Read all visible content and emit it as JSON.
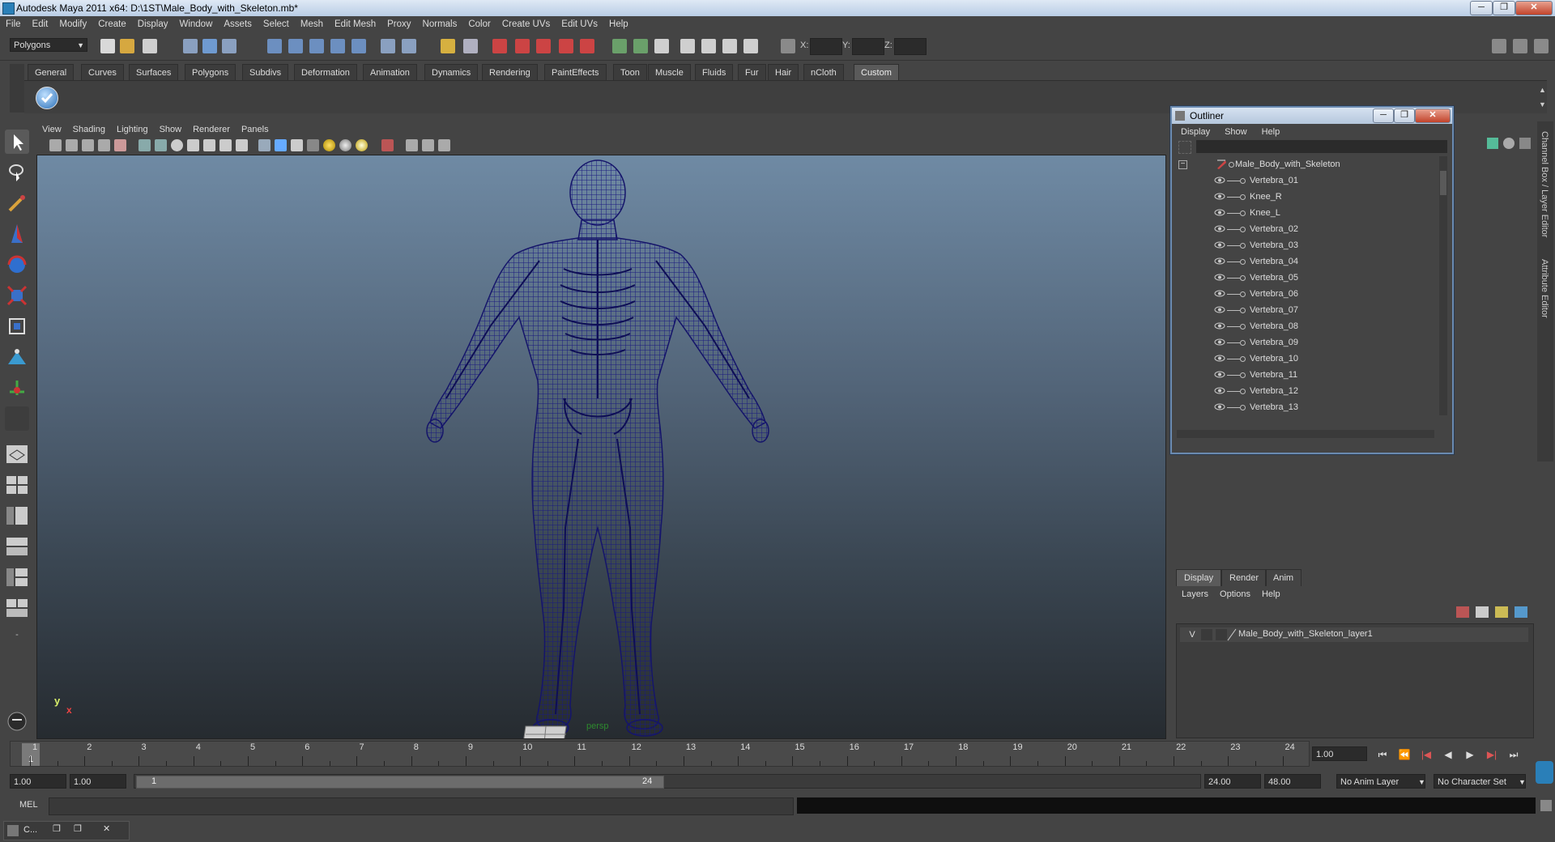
{
  "window": {
    "title": "Autodesk Maya 2011 x64: D:\\1ST\\Male_Body_with_Skeleton.mb*",
    "minimize": "─",
    "restore": "❐",
    "close": "✕"
  },
  "menu": [
    "File",
    "Edit",
    "Modify",
    "Create",
    "Display",
    "Window",
    "Assets",
    "Select",
    "Mesh",
    "Edit Mesh",
    "Proxy",
    "Normals",
    "Color",
    "Create UVs",
    "Edit UVs",
    "Help"
  ],
  "status_line": {
    "mode": "Polygons",
    "x_label": "X:",
    "y_label": "Y:",
    "z_label": "Z:"
  },
  "shelf_tabs": [
    "General",
    "Curves",
    "Surfaces",
    "Polygons",
    "Subdivs",
    "Deformation",
    "Animation",
    "Dynamics",
    "Rendering",
    "PaintEffects",
    "Toon",
    "Muscle",
    "Fluids",
    "Fur",
    "Hair",
    "nCloth",
    "Custom"
  ],
  "active_shelf": "Custom",
  "viewport": {
    "menu": [
      "View",
      "Shading",
      "Lighting",
      "Show",
      "Renderer",
      "Panels"
    ],
    "camera_label": "persp",
    "axis_y": "y",
    "axis_x": "x",
    "wire_color": "#1c1c7a"
  },
  "outliner": {
    "title": "Outliner",
    "menu": [
      "Display",
      "Show",
      "Help"
    ],
    "root": "Male_Body_with_Skeleton",
    "collapse_glyph": "−",
    "items": [
      "Vertebra_01",
      "Knee_R",
      "Knee_L",
      "Vertebra_02",
      "Vertebra_03",
      "Vertebra_04",
      "Vertebra_05",
      "Vertebra_06",
      "Vertebra_07",
      "Vertebra_08",
      "Vertebra_09",
      "Vertebra_10",
      "Vertebra_11",
      "Vertebra_12",
      "Vertebra_13"
    ]
  },
  "side_tabs": {
    "channel_box": "Channel Box / Layer Editor",
    "attribute_editor": "Attribute Editor"
  },
  "layer_editor": {
    "tabs": [
      "Display",
      "Render",
      "Anim"
    ],
    "menu": [
      "Layers",
      "Options",
      "Help"
    ],
    "layer": {
      "visible": "V",
      "name": "Male_Body_with_Skeleton_layer1"
    }
  },
  "timeline": {
    "ticks": [
      "1",
      "2",
      "3",
      "4",
      "5",
      "6",
      "7",
      "8",
      "9",
      "10",
      "11",
      "12",
      "13",
      "14",
      "15",
      "16",
      "17",
      "18",
      "19",
      "20",
      "21",
      "22",
      "23",
      "24"
    ],
    "current_marker": "1",
    "current_field": "1.00",
    "buttons": [
      "⏮",
      "⏪",
      "|◀",
      "◀",
      "▶",
      "▶|",
      "⏭"
    ]
  },
  "range": {
    "start": "1.00",
    "inner_start": "1.00",
    "thumb_start": "1",
    "thumb_end": "24",
    "inner_end": "24.00",
    "end": "48.00",
    "anim_layer": "No Anim Layer",
    "character_set": "No Character Set"
  },
  "command_line": {
    "label": "MEL"
  },
  "taskbar": {
    "label": "C..."
  }
}
